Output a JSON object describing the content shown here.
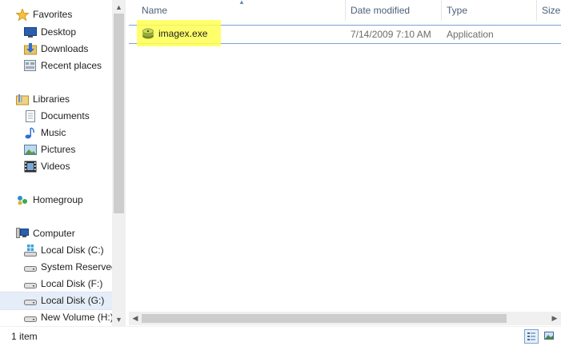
{
  "navigation": {
    "favorites": {
      "label": "Favorites",
      "items": [
        {
          "label": "Desktop",
          "icon": "desktop-icon"
        },
        {
          "label": "Downloads",
          "icon": "downloads-icon"
        },
        {
          "label": "Recent places",
          "icon": "recent-places-icon"
        }
      ]
    },
    "libraries": {
      "label": "Libraries",
      "items": [
        {
          "label": "Documents",
          "icon": "documents-icon"
        },
        {
          "label": "Music",
          "icon": "music-icon"
        },
        {
          "label": "Pictures",
          "icon": "pictures-icon"
        },
        {
          "label": "Videos",
          "icon": "videos-icon"
        }
      ]
    },
    "homegroup": {
      "label": "Homegroup"
    },
    "computer": {
      "label": "Computer",
      "items": [
        {
          "label": "Local Disk (C:)",
          "icon": "windows-drive-icon"
        },
        {
          "label": "System Reserved",
          "icon": "drive-icon"
        },
        {
          "label": "Local Disk (F:)",
          "icon": "drive-icon"
        },
        {
          "label": "Local Disk (G:)",
          "icon": "drive-icon",
          "selected": true
        },
        {
          "label": "New Volume (H:)",
          "icon": "drive-icon"
        }
      ]
    }
  },
  "columns": {
    "name": "Name",
    "date_modified": "Date modified",
    "type": "Type",
    "size": "Size"
  },
  "files": [
    {
      "name": "imagex.exe",
      "date_modified": "7/14/2009 7:10 AM",
      "type": "Application",
      "icon": "application-icon",
      "highlighted": true
    }
  ],
  "status": {
    "item_count": "1 item"
  },
  "colors": {
    "highlight": "#ffff52",
    "selection_border": "#7da2ce",
    "header_text": "#4c607a"
  }
}
